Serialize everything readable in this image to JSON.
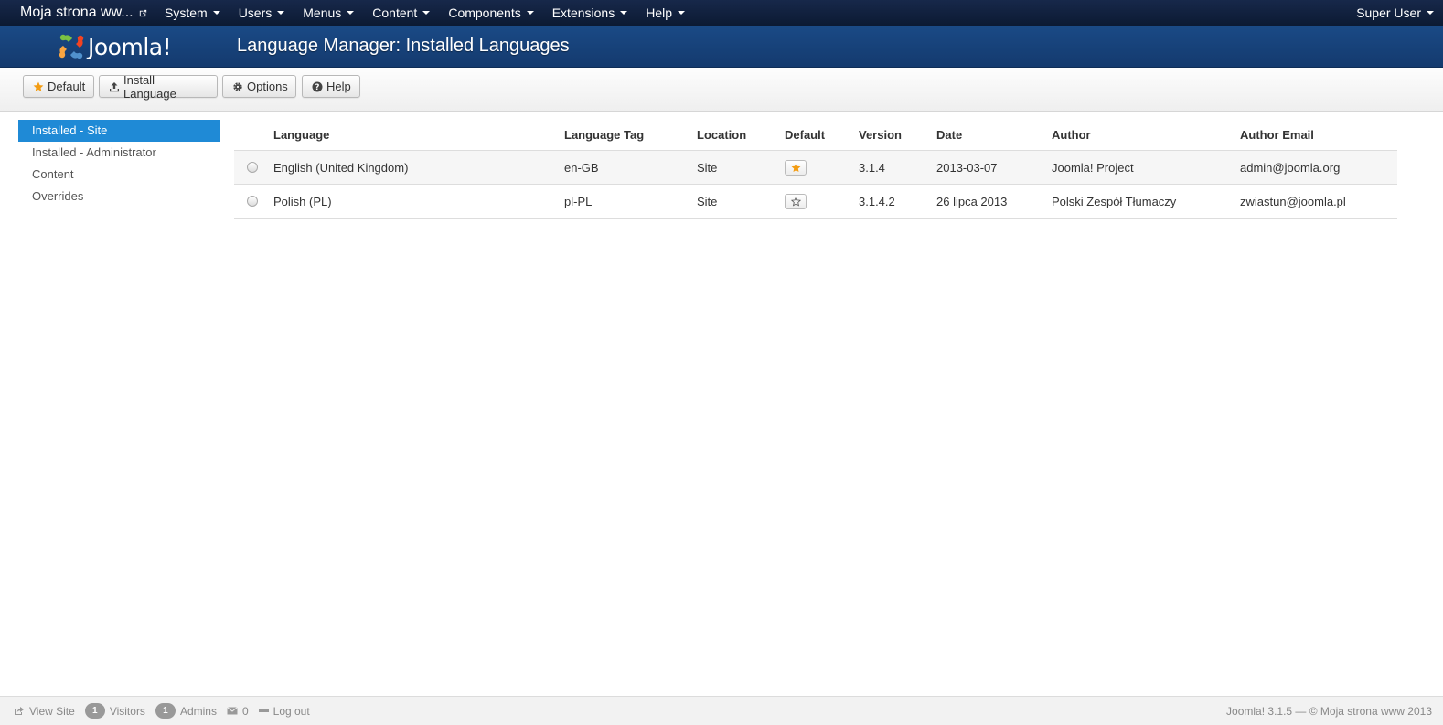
{
  "navbar": {
    "site_name": "Moja strona ww...",
    "menu": [
      {
        "label": "System"
      },
      {
        "label": "Users"
      },
      {
        "label": "Menus"
      },
      {
        "label": "Content"
      },
      {
        "label": "Components"
      },
      {
        "label": "Extensions"
      },
      {
        "label": "Help"
      }
    ],
    "user": "Super User"
  },
  "header": {
    "logo_text": "Joomla!",
    "title": "Language Manager: Installed Languages"
  },
  "toolbar": {
    "default_label": "Default",
    "install_label": "Install Language",
    "options_label": "Options",
    "help_label": "Help"
  },
  "sidebar": {
    "items": [
      {
        "label": "Installed - Site",
        "active": true
      },
      {
        "label": "Installed - Administrator",
        "active": false
      },
      {
        "label": "Content",
        "active": false
      },
      {
        "label": "Overrides",
        "active": false
      }
    ]
  },
  "table": {
    "headers": {
      "language": "Language",
      "tag": "Language Tag",
      "location": "Location",
      "default": "Default",
      "version": "Version",
      "date": "Date",
      "author": "Author",
      "email": "Author Email"
    },
    "rows": [
      {
        "language": "English (United Kingdom)",
        "tag": "en-GB",
        "location": "Site",
        "is_default": true,
        "version": "3.1.4",
        "date": "2013-03-07",
        "author": "Joomla! Project",
        "email": "admin@joomla.org"
      },
      {
        "language": "Polish (PL)",
        "tag": "pl-PL",
        "location": "Site",
        "is_default": false,
        "version": "3.1.4.2",
        "date": "26 lipca 2013",
        "author": "Polski Zespół Tłumaczy",
        "email": "zwiastun@joomla.pl"
      }
    ]
  },
  "status": {
    "view_site": "View Site",
    "visitors_count": "1",
    "visitors_label": "Visitors",
    "admins_count": "1",
    "admins_label": "Admins",
    "messages_count": "0",
    "logout": "Log out",
    "copyright": "Joomla! 3.1.5  —  © Moja strona www 2013"
  },
  "colors": {
    "navbar_bg": "#0f1e3a",
    "header_bg": "#1a4a86",
    "active_item": "#1f8ad6",
    "star_active": "#f39c12"
  }
}
